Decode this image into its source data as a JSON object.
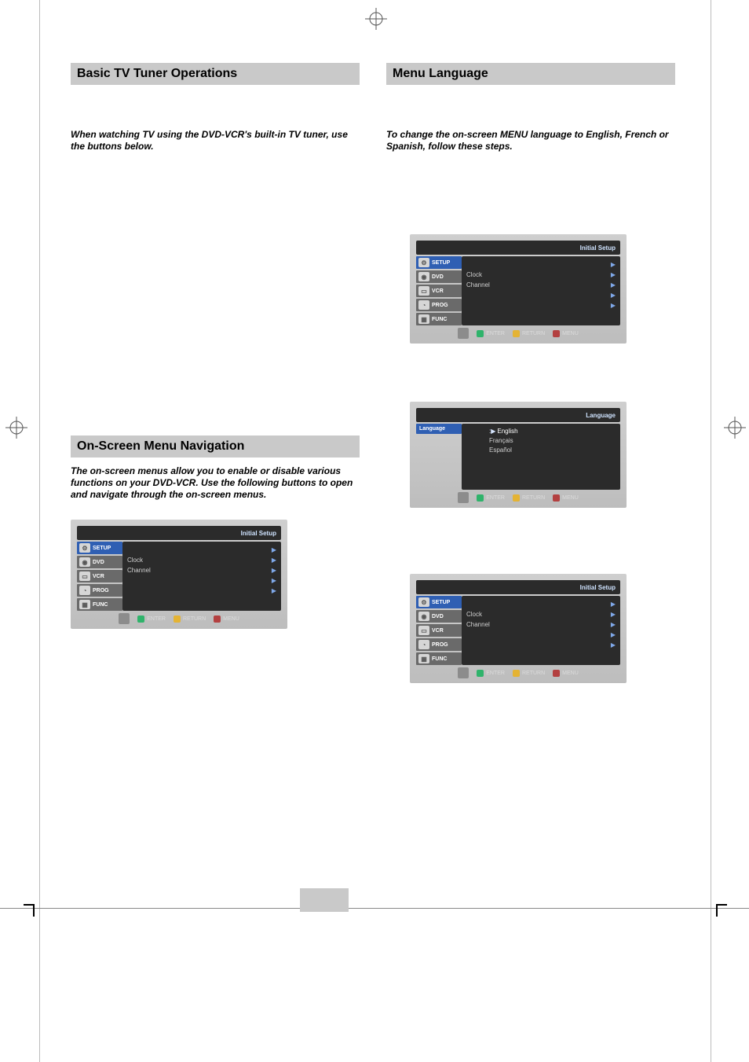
{
  "sections": {
    "basic_tv": {
      "title": "Basic TV Tuner Operations",
      "intro": "When watching TV using the DVD-VCR's built-in TV tuner, use the buttons below."
    },
    "menu_lang": {
      "title": "Menu Language",
      "intro": "To change the on-screen MENU language to English, French or Spanish, follow these steps."
    },
    "osmn": {
      "title": "On-Screen Menu Navigation",
      "intro": "The on-screen menus allow you to enable or disable various functions on your DVD-VCR. Use the following buttons to open and navigate through the on-screen menus."
    }
  },
  "osd": {
    "panel_title": "Initial Setup",
    "tabs": [
      "SETUP",
      "DVD",
      "VCR",
      "PROG",
      "FUNC"
    ],
    "main_rows": [
      "Clock",
      "Channel"
    ],
    "hidden_rows_count": 3,
    "footer": {
      "enter": "ENTER",
      "return": "RETURN",
      "menu": "MENU"
    }
  },
  "lang_osd": {
    "panel_title": "Language",
    "left_label": "Language",
    "options": [
      "English",
      "Français",
      "Español"
    ],
    "selected": "English"
  }
}
